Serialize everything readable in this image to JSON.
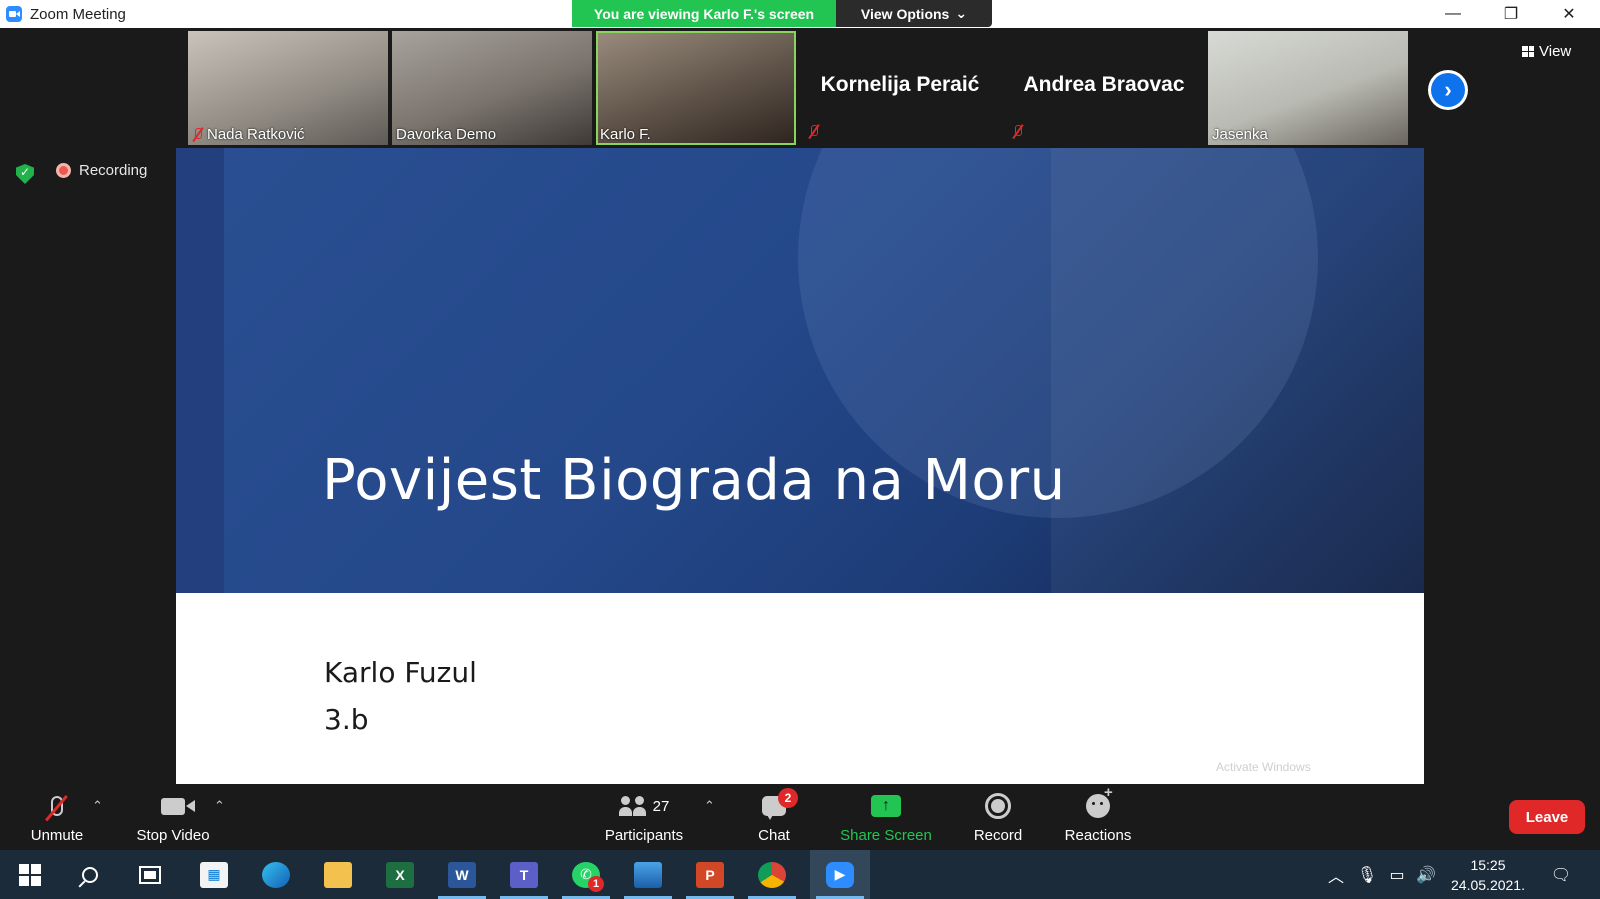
{
  "window": {
    "title": "Zoom Meeting",
    "viewing_banner": "You are viewing Karlo F.'s screen",
    "view_options": "View Options",
    "view_button": "View"
  },
  "participants_strip": [
    {
      "name": "Nada Ratković",
      "muted": true,
      "video": true
    },
    {
      "name": "Davorka Demo",
      "muted": false,
      "video": true
    },
    {
      "name": "Karlo F.",
      "muted": false,
      "video": true,
      "active_speaker": true
    },
    {
      "name": "Kornelija Peraić",
      "muted": true,
      "video": false
    },
    {
      "name": "Andrea Braovac",
      "muted": true,
      "video": false
    },
    {
      "name": "Jasenka",
      "muted": false,
      "video": true
    }
  ],
  "status": {
    "recording_label": "Recording"
  },
  "slide": {
    "title": "Povijest Biograda na Moru",
    "author": "Karlo Fuzul",
    "class": "3.b",
    "watermark": "Activate Windows"
  },
  "toolbar": {
    "unmute": "Unmute",
    "stop_video": "Stop Video",
    "participants_label": "Participants",
    "participants_count": "27",
    "chat": "Chat",
    "chat_badge": "2",
    "share_screen": "Share Screen",
    "record": "Record",
    "reactions": "Reactions",
    "leave": "Leave"
  },
  "taskbar": {
    "apps": [
      "start",
      "search",
      "task-view",
      "store",
      "edge",
      "file-explorer",
      "excel",
      "word",
      "teams",
      "whatsapp",
      "photos",
      "powerpoint",
      "chrome",
      "zoom"
    ],
    "whatsapp_badge": "1",
    "time": "15:25",
    "date": "24.05.2021."
  },
  "colors": {
    "zoom_blue": "#2d8cff",
    "banner_green": "#23c552",
    "leave_red": "#e02828",
    "slide_blue": "#24488a"
  }
}
